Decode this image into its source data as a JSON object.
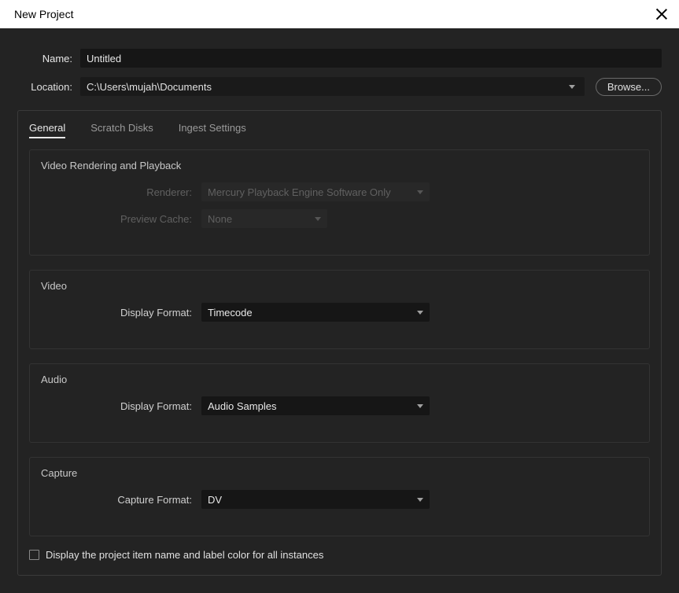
{
  "titlebar": {
    "title": "New Project"
  },
  "form": {
    "name_label": "Name:",
    "name_value": "Untitled",
    "location_label": "Location:",
    "location_value": "C:\\Users\\mujah\\Documents",
    "browse_label": "Browse..."
  },
  "tabs": {
    "general": "General",
    "scratch": "Scratch Disks",
    "ingest": "Ingest Settings"
  },
  "video_rendering": {
    "title": "Video Rendering and Playback",
    "renderer_label": "Renderer:",
    "renderer_value": "Mercury Playback Engine Software Only",
    "cache_label": "Preview Cache:",
    "cache_value": "None"
  },
  "video": {
    "title": "Video",
    "format_label": "Display Format:",
    "format_value": "Timecode"
  },
  "audio": {
    "title": "Audio",
    "format_label": "Display Format:",
    "format_value": "Audio Samples"
  },
  "capture": {
    "title": "Capture",
    "format_label": "Capture Format:",
    "format_value": "DV"
  },
  "checkbox": {
    "label": "Display the project item name and label color for all instances"
  }
}
